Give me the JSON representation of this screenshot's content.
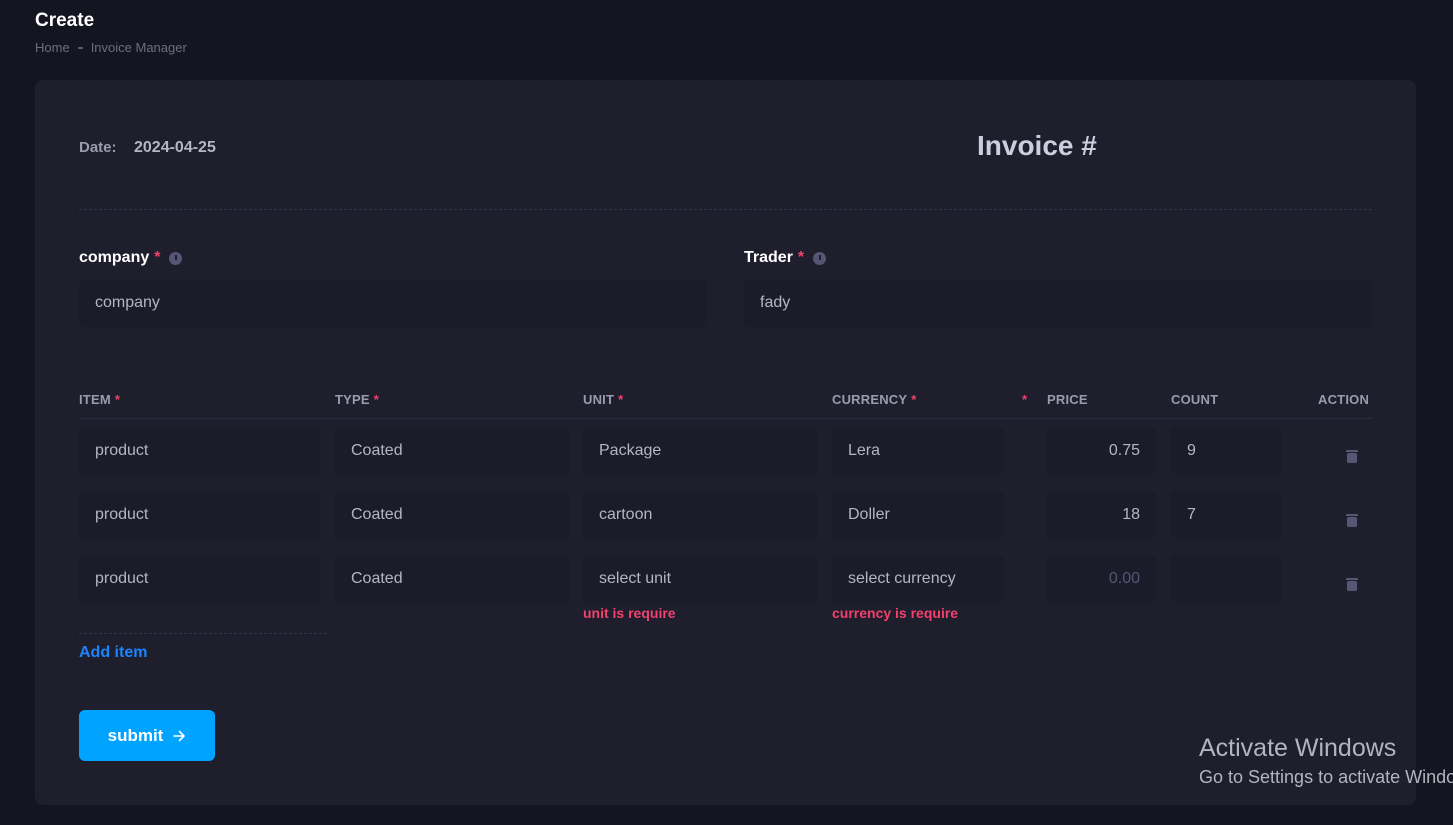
{
  "page": {
    "title": "Create"
  },
  "breadcrumb": {
    "home": "Home",
    "current": "Invoice Manager"
  },
  "invoice": {
    "date_label": "Date:",
    "date_value": "2024-04-25",
    "title": "Invoice #"
  },
  "company": {
    "label": "company",
    "required_mark": "*",
    "value": "company"
  },
  "trader": {
    "label": "Trader",
    "required_mark": "*",
    "value": "fady"
  },
  "table": {
    "headers": {
      "item": "ITEM",
      "type": "TYPE",
      "unit": "UNIT",
      "currency": "CURRENCY",
      "extra_required": "*",
      "price": "PRICE",
      "count": "COUNT",
      "action": "ACTION"
    },
    "required_mark": "*",
    "rows": [
      {
        "item": "product",
        "type": "Coated",
        "unit": "Package",
        "currency": "Lera",
        "price": "0.75",
        "count": "9"
      },
      {
        "item": "product",
        "type": "Coated",
        "unit": "cartoon",
        "currency": "Doller",
        "price": "18",
        "count": "7"
      },
      {
        "item": "product",
        "type": "Coated",
        "unit": "select unit",
        "currency": "select currency",
        "price": "0.00",
        "count": ""
      }
    ],
    "errors": {
      "unit": "unit is require",
      "currency": "currency is require"
    }
  },
  "actions": {
    "add_item": "Add item",
    "submit": "submit",
    "submit_icon": "arrow-right-icon"
  },
  "watermark": {
    "title": "Activate Windows",
    "subtitle": "Go to Settings to activate Windows."
  },
  "colors": {
    "accent": "#00a3ff",
    "link": "#1b84ff",
    "danger": "#f1416c",
    "card": "#1e1e2d",
    "background": "#151521"
  }
}
